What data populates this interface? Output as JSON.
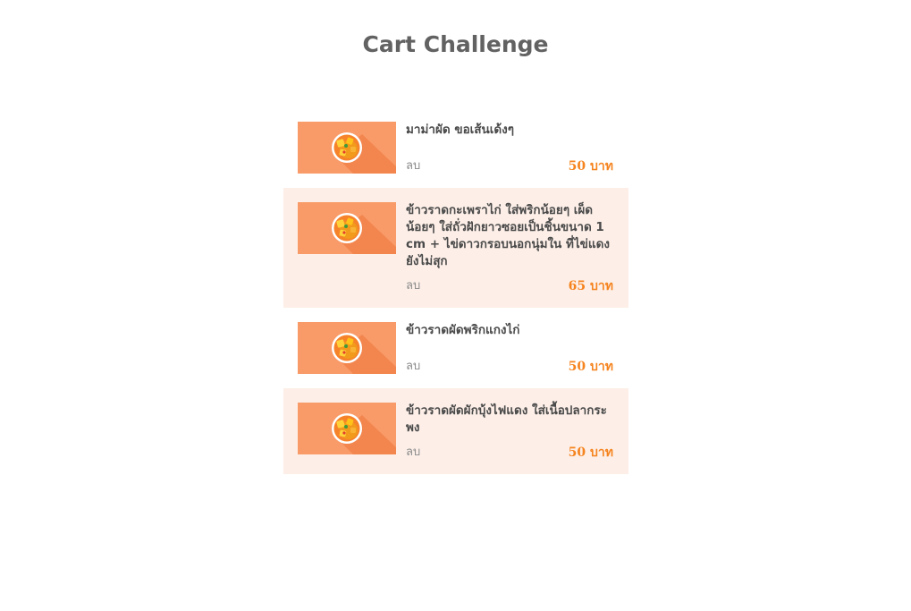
{
  "page": {
    "title": "Cart Challenge"
  },
  "colors": {
    "accent": "#f5841f",
    "alt_row_bg": "#fdefe8",
    "thumb_bg": "#f99b69"
  },
  "cart": {
    "items": [
      {
        "name": "มาม่าผัด ขอเส้นเด้งๆ",
        "remove_label": "ลบ",
        "price": "50 บาท",
        "icon": "curry-bowl-icon"
      },
      {
        "name": "ข้าวราดกะเพราไก่ ใส่พริกน้อยๆ เผ็ดน้อยๆ ใส่ถั่วฝักยาวซอยเป็นชิ้นขนาด 1 cm + ไข่ดาวกรอบนอกนุ่มใน ที่ไข่แดงยังไม่สุก",
        "remove_label": "ลบ",
        "price": "65 บาท",
        "icon": "curry-bowl-icon"
      },
      {
        "name": "ข้าวราดผัดพริกแกงไก่",
        "remove_label": "ลบ",
        "price": "50 บาท",
        "icon": "curry-bowl-icon"
      },
      {
        "name": "ข้าวราดผัดผักบุ้งไฟแดง ใส่เนื้อปลากระพง",
        "remove_label": "ลบ",
        "price": "50 บาท",
        "icon": "curry-bowl-icon"
      }
    ]
  }
}
